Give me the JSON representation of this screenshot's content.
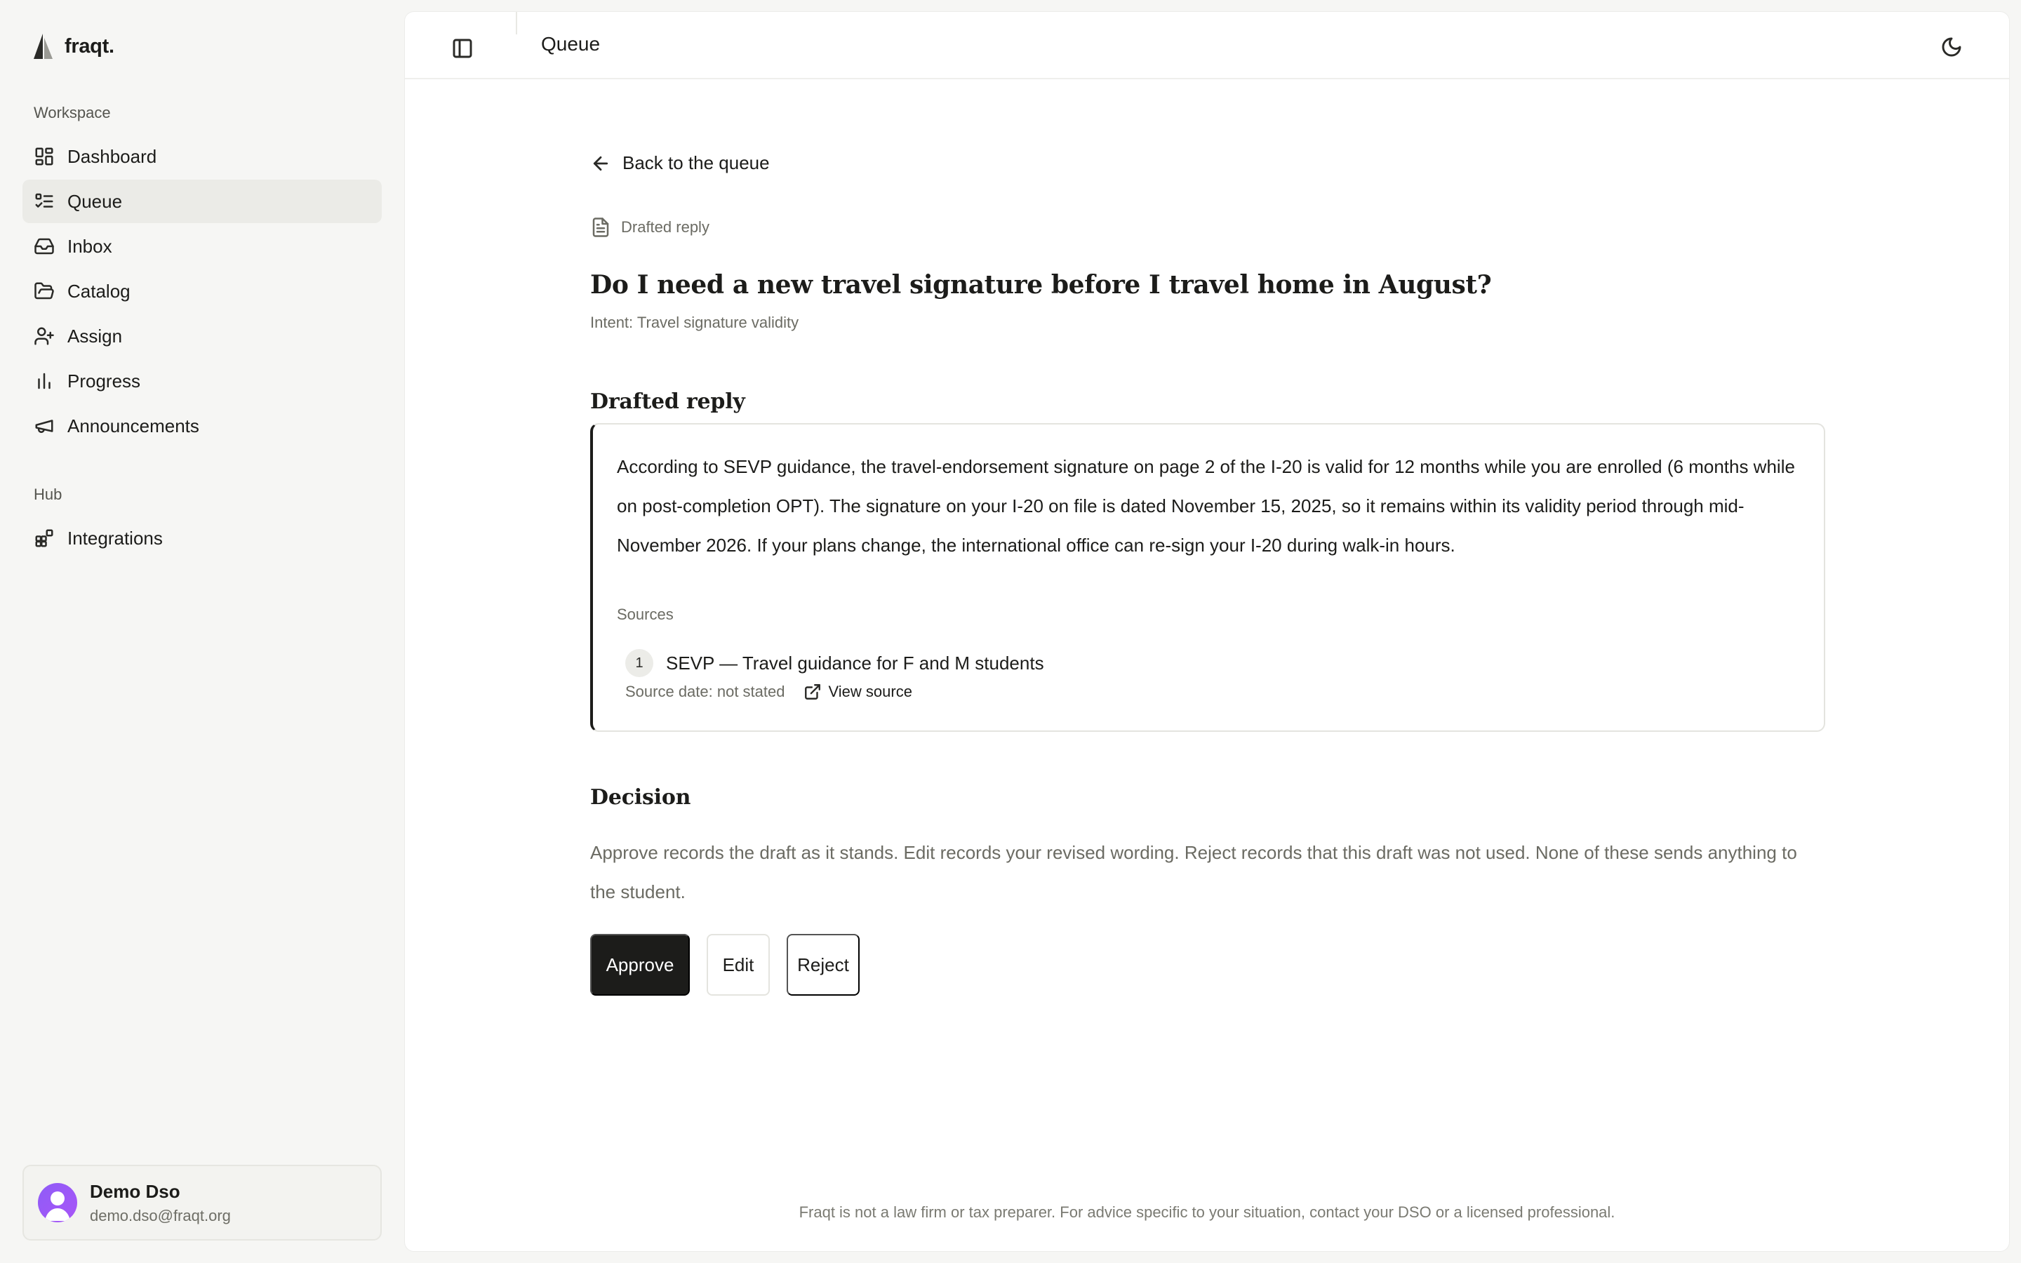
{
  "brand": {
    "name": "fraqt."
  },
  "sidebar": {
    "workspace_label": "Workspace",
    "workspace_items": [
      {
        "label": "Dashboard",
        "icon": "dashboard-icon"
      },
      {
        "label": "Queue",
        "icon": "queue-icon",
        "active": true
      },
      {
        "label": "Inbox",
        "icon": "inbox-icon"
      },
      {
        "label": "Catalog",
        "icon": "folder-icon"
      },
      {
        "label": "Assign",
        "icon": "user-plus-icon"
      },
      {
        "label": "Progress",
        "icon": "bar-chart-icon"
      },
      {
        "label": "Announcements",
        "icon": "megaphone-icon"
      }
    ],
    "hub_label": "Hub",
    "hub_items": [
      {
        "label": "Integrations",
        "icon": "integrations-icon"
      }
    ]
  },
  "user": {
    "name": "Demo Dso",
    "email": "demo.dso@fraqt.org"
  },
  "topbar": {
    "title": "Queue"
  },
  "page": {
    "back_label": "Back to the queue",
    "crumb_label": "Drafted reply",
    "question": "Do I need a new travel signature before I travel home in August?",
    "intent": "Intent: Travel signature validity",
    "reply_heading": "Drafted reply",
    "reply_text": "According to SEVP guidance, the travel-endorsement signature on page 2 of the I-20 is valid for 12 months while you are enrolled (6 months while on post-completion OPT). The signature on your I-20 on file is dated November 15, 2025, so it remains within its validity period through mid-November 2026. If your plans change, the international office can re-sign your I-20 during walk-in hours.",
    "sources_label": "Sources",
    "sources": [
      {
        "number": "1",
        "title": "SEVP — Travel guidance for F and M students",
        "date": "Source date: not stated",
        "link_label": "View source"
      }
    ],
    "decision_heading": "Decision",
    "decision_text": "Approve records the draft as it stands. Edit records your revised wording. Reject records that this draft was not used. None of these sends anything to the student.",
    "actions": {
      "approve": "Approve",
      "edit": "Edit",
      "reject": "Reject"
    },
    "footer": "Fraqt is not a law firm or tax preparer. For advice specific to your situation, contact your DSO or a licensed professional."
  },
  "colors": {
    "accent": "#1c1c1a",
    "avatar": "#8f5cf7",
    "muted": "#6b6b63"
  }
}
